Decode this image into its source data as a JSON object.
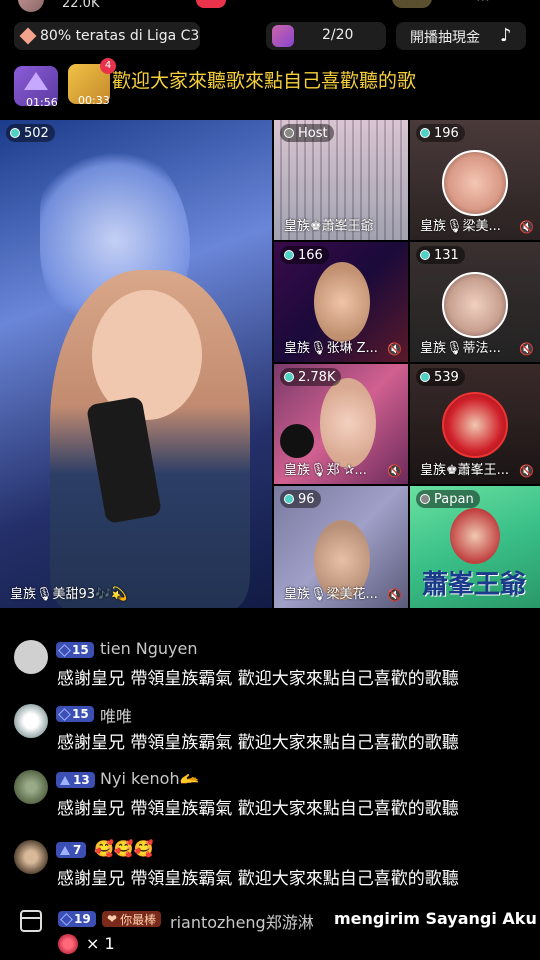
{
  "top": {
    "viewer_count": "22.0K"
  },
  "header": {
    "league_text": "80% teratas di Liga C3",
    "participants": "2/20",
    "cash_draw_label": "開播抽現金",
    "timer_1": "01:56",
    "timer_2": "00:33",
    "timer_2_badge": "4",
    "marquee": "歡迎大家來聽歌來點自己喜歡聽的歌"
  },
  "tiles": [
    {
      "viewers": "502",
      "name": "皇族🎙美甜93🎶💫"
    },
    {
      "viewers": "Host",
      "name": "皇族♚蕭峯王爺"
    },
    {
      "viewers": "196",
      "name": "皇族🎙梁美..."
    },
    {
      "viewers": "166",
      "name": "皇族🎙张琳 Z..."
    },
    {
      "viewers": "131",
      "name": "皇族🎙蒂法..."
    },
    {
      "viewers": "2.78K",
      "name": "皇族🎙郑 ✰..."
    },
    {
      "viewers": "539",
      "name": "皇族♚蕭峯王..."
    },
    {
      "viewers": "96",
      "name": "皇族🎙梁美花..."
    },
    {
      "viewers": "Papan",
      "name": "蕭峯王爺"
    }
  ],
  "comments": [
    {
      "level": "15",
      "user": "tien Nguyen",
      "message": "感謝皇兄 帶領皇族霸氣 歡迎大家來點自己喜歡的歌聽"
    },
    {
      "level": "15",
      "user": "唯唯",
      "message": "感謝皇兄 帶領皇族霸氣 歡迎大家來點自己喜歡的歌聽"
    },
    {
      "level": "13",
      "user": "Nyi kenoh🫴",
      "message": "感謝皇兄 帶領皇族霸氣 歡迎大家來點自己喜歡的歌聽"
    },
    {
      "level": "7",
      "user": "🥰🥰🥰",
      "message": "感謝皇兄 帶領皇族霸氣 歡迎大家來點自己喜歡的歌聽"
    }
  ],
  "gift": {
    "level": "19",
    "fan_badge": "你最棒",
    "user": "riantozheng郑游淋",
    "text": "mengirim Sayangi Aku",
    "count": "× 1"
  },
  "colors": {
    "marquee": "#f6d03c",
    "level_badge": "#3b4fb4",
    "viewer_dot": "#4fd1c5"
  }
}
